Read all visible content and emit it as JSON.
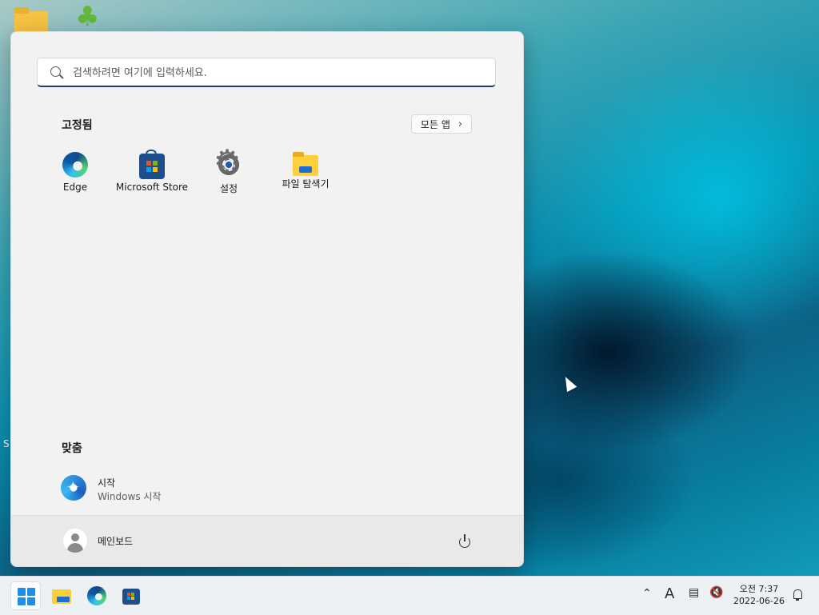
{
  "desktop": {
    "partial_label": "S"
  },
  "start_menu": {
    "search": {
      "placeholder": "검색하려면 여기에 입력하세요."
    },
    "pinned": {
      "title": "고정됨",
      "all_apps_label": "모든 앱",
      "apps": [
        {
          "label": "Edge",
          "icon": "edge-icon"
        },
        {
          "label": "Microsoft Store",
          "icon": "store-icon"
        },
        {
          "label": "설정",
          "icon": "settings-gear-icon"
        },
        {
          "label": "파일 탐색기",
          "icon": "file-explorer-icon"
        }
      ]
    },
    "recommended": {
      "title": "맞춤",
      "items": [
        {
          "name": "시작",
          "description": "Windows 시작",
          "icon": "get-started-icon"
        }
      ]
    },
    "footer": {
      "user_name": "메인보드"
    }
  },
  "taskbar": {
    "apps": [
      "start-icon",
      "file-explorer-icon",
      "edge-icon",
      "store-icon"
    ],
    "tray": {
      "ime_indicator": "A",
      "time": "오전 7:37",
      "date": "2022-06-26"
    }
  },
  "colors": {
    "accent": "#1f8fe6",
    "search_underline": "#1f3b73",
    "menu_background": "#f2f2f2"
  }
}
